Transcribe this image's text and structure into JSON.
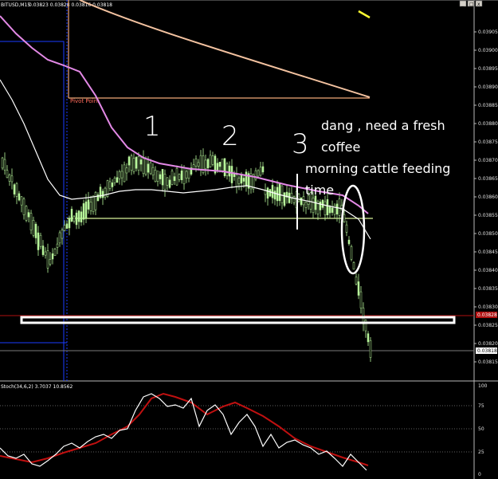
{
  "window": {
    "title": "BITUSD,M15",
    "ohlc": "0.03823 0.03828 0.03816 0.03818",
    "buttons": [
      "_",
      "□",
      "x"
    ]
  },
  "price_axis": {
    "labels": [
      "0.03905",
      "0.03900",
      "0.03895",
      "0.03890",
      "0.03885",
      "0.03880",
      "0.03875",
      "0.03870",
      "0.03865",
      "0.03860",
      "0.03855",
      "0.03850",
      "0.03845",
      "0.03840",
      "0.03835",
      "0.03830",
      "0.03825",
      "0.03820",
      "0.03815"
    ],
    "marked_red": "0.03828",
    "marked_white": "0.03818"
  },
  "pivot_label": "Pivot Point",
  "annotations": {
    "num1": "1",
    "num2": "2",
    "num3": "3",
    "note_line1": "dang , need a fresh",
    "note_line2": "coffee",
    "note_line3": "morning cattle feeding",
    "note_line4": "time"
  },
  "indicator": {
    "label": "Stoch(34,6,2) 3.7037 10.8562",
    "levels": [
      "100",
      "75",
      "50",
      "25",
      "0"
    ]
  },
  "colors": {
    "background": "#000000",
    "bull": "#b7f59a",
    "ma_purple": "#e389e6",
    "ma_white": "#ffffff",
    "pivot": "#f0a878",
    "support_line": "#d9f29a",
    "red_line": "#b01010",
    "blue_box": "#1a3cff",
    "stoch_main": "#ffffff",
    "stoch_signal": "#c01010"
  }
}
